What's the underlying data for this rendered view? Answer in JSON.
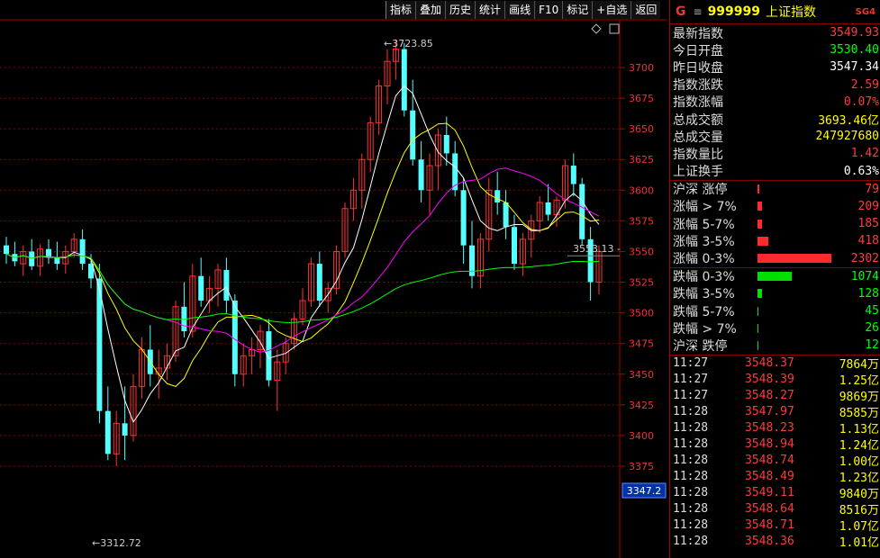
{
  "toolbar": {
    "buttons": [
      "指标",
      "叠加",
      "历史",
      "统计",
      "画线",
      "F10",
      "标记",
      "+自选",
      "返回"
    ]
  },
  "chart": {
    "y_ticks": [
      "3700",
      "3675",
      "3650",
      "3625",
      "3600",
      "3575",
      "3550",
      "3525",
      "3500",
      "3475",
      "3450",
      "3425",
      "3400",
      "3375"
    ],
    "high_label": "3723.85",
    "low_label": "3312.72",
    "current_label": "3553.13",
    "cursor_price": "3347.2",
    "diamond_icon": "diamond-icon",
    "window_icon": "window-icon"
  },
  "chart_data": {
    "type": "candlestick",
    "ylim": [
      3300,
      3740
    ],
    "grid": true,
    "candles": [
      [
        3555,
        3562,
        3540,
        3548
      ],
      [
        3548,
        3558,
        3538,
        3542
      ],
      [
        3540,
        3555,
        3530,
        3550
      ],
      [
        3550,
        3560,
        3535,
        3538
      ],
      [
        3538,
        3556,
        3530,
        3552
      ],
      [
        3552,
        3560,
        3540,
        3545
      ],
      [
        3545,
        3558,
        3535,
        3540
      ],
      [
        3540,
        3555,
        3532,
        3550
      ],
      [
        3550,
        3565,
        3545,
        3560
      ],
      [
        3560,
        3568,
        3535,
        3540
      ],
      [
        3540,
        3548,
        3520,
        3528
      ],
      [
        3528,
        3540,
        3410,
        3420
      ],
      [
        3420,
        3440,
        3380,
        3385
      ],
      [
        3385,
        3420,
        3375,
        3410
      ],
      [
        3410,
        3440,
        3380,
        3400
      ],
      [
        3400,
        3450,
        3395,
        3440
      ],
      [
        3440,
        3480,
        3430,
        3470
      ],
      [
        3470,
        3490,
        3440,
        3450
      ],
      [
        3450,
        3470,
        3430,
        3455
      ],
      [
        3455,
        3475,
        3445,
        3465
      ],
      [
        3465,
        3510,
        3460,
        3505
      ],
      [
        3505,
        3525,
        3480,
        3485
      ],
      [
        3485,
        3540,
        3480,
        3530
      ],
      [
        3530,
        3545,
        3505,
        3510
      ],
      [
        3510,
        3530,
        3500,
        3520
      ],
      [
        3520,
        3540,
        3505,
        3535
      ],
      [
        3535,
        3545,
        3500,
        3510
      ],
      [
        3510,
        3515,
        3440,
        3450
      ],
      [
        3450,
        3475,
        3440,
        3465
      ],
      [
        3465,
        3480,
        3450,
        3470
      ],
      [
        3470,
        3490,
        3455,
        3485
      ],
      [
        3485,
        3495,
        3440,
        3445
      ],
      [
        3445,
        3470,
        3420,
        3460
      ],
      [
        3460,
        3480,
        3450,
        3475
      ],
      [
        3475,
        3500,
        3470,
        3495
      ],
      [
        3495,
        3520,
        3490,
        3510
      ],
      [
        3510,
        3545,
        3505,
        3540
      ],
      [
        3540,
        3550,
        3505,
        3510
      ],
      [
        3510,
        3525,
        3500,
        3520
      ],
      [
        3520,
        3555,
        3515,
        3550
      ],
      [
        3550,
        3590,
        3545,
        3585
      ],
      [
        3585,
        3610,
        3575,
        3600
      ],
      [
        3600,
        3630,
        3585,
        3625
      ],
      [
        3625,
        3660,
        3615,
        3655
      ],
      [
        3655,
        3690,
        3645,
        3685
      ],
      [
        3685,
        3715,
        3670,
        3705
      ],
      [
        3705,
        3723,
        3690,
        3715
      ],
      [
        3715,
        3720,
        3660,
        3665
      ],
      [
        3665,
        3690,
        3620,
        3625
      ],
      [
        3625,
        3640,
        3590,
        3600
      ],
      [
        3600,
        3630,
        3580,
        3620
      ],
      [
        3620,
        3650,
        3600,
        3645
      ],
      [
        3645,
        3660,
        3620,
        3630
      ],
      [
        3630,
        3640,
        3595,
        3600
      ],
      [
        3600,
        3610,
        3540,
        3555
      ],
      [
        3555,
        3575,
        3520,
        3530
      ],
      [
        3530,
        3565,
        3520,
        3560
      ],
      [
        3560,
        3610,
        3550,
        3600
      ],
      [
        3600,
        3615,
        3580,
        3590
      ],
      [
        3590,
        3600,
        3560,
        3570
      ],
      [
        3570,
        3580,
        3535,
        3540
      ],
      [
        3540,
        3565,
        3530,
        3560
      ],
      [
        3560,
        3580,
        3545,
        3575
      ],
      [
        3575,
        3595,
        3565,
        3590
      ],
      [
        3590,
        3605,
        3575,
        3580
      ],
      [
        3580,
        3595,
        3570,
        3592
      ],
      [
        3592,
        3625,
        3585,
        3620
      ],
      [
        3620,
        3630,
        3595,
        3605
      ],
      [
        3605,
        3610,
        3555,
        3560
      ],
      [
        3560,
        3570,
        3510,
        3525
      ],
      [
        3525,
        3555,
        3515,
        3550
      ]
    ],
    "ma_yellow_note": "5-day moving average",
    "ma_white_note": "10-day moving average",
    "ma_magenta_note": "20-day moving average",
    "ma_green_note": "60-day moving average"
  },
  "panel": {
    "header": {
      "g": "G",
      "menu": "≡",
      "code": "999999",
      "name": "上证指数",
      "sg": "SG4"
    },
    "stats": [
      {
        "label": "最新指数",
        "value": "3549.93",
        "color": "#ff3b3b"
      },
      {
        "label": "今日开盘",
        "value": "3530.40",
        "color": "#00ff00"
      },
      {
        "label": "昨日收盘",
        "value": "3547.34",
        "color": "#ffffff"
      },
      {
        "label": "指数涨跌",
        "value": "2.59",
        "color": "#ff3b3b"
      },
      {
        "label": "指数涨幅",
        "value": "0.07%",
        "color": "#ff3b3b"
      },
      {
        "label": "总成交额",
        "value": "3693.46亿",
        "color": "#ffff00"
      },
      {
        "label": "总成交量",
        "value": "247927680",
        "color": "#ffff00"
      },
      {
        "label": "指数量比",
        "value": "1.42",
        "color": "#ff3b3b"
      },
      {
        "label": "上证换手",
        "value": "0.63%",
        "color": "#ffffff"
      }
    ],
    "up": [
      {
        "label": "沪深 涨停",
        "value": "79",
        "width": 2
      },
      {
        "label": "涨幅 > 7%",
        "value": "209",
        "width": 5
      },
      {
        "label": "涨幅 5-7%",
        "value": "185",
        "width": 5
      },
      {
        "label": "涨幅 3-5%",
        "value": "418",
        "width": 12
      },
      {
        "label": "涨幅 0-3%",
        "value": "2302",
        "width": 82
      }
    ],
    "down": [
      {
        "label": "跌幅 0-3%",
        "value": "1074",
        "width": 38
      },
      {
        "label": "跌幅 3-5%",
        "value": "128",
        "width": 5
      },
      {
        "label": "跌幅 5-7%",
        "value": "45",
        "width": 1
      },
      {
        "label": "跌幅 > 7%",
        "value": "26",
        "width": 1
      },
      {
        "label": "沪深 跌停",
        "value": "12",
        "width": 1
      }
    ],
    "ticks": [
      {
        "t": "11:27",
        "p": "3548.37",
        "v": "7864万"
      },
      {
        "t": "11:27",
        "p": "3548.39",
        "v": "1.25亿"
      },
      {
        "t": "11:27",
        "p": "3548.27",
        "v": "9869万"
      },
      {
        "t": "11:28",
        "p": "3547.97",
        "v": "8585万"
      },
      {
        "t": "11:28",
        "p": "3548.23",
        "v": "1.13亿"
      },
      {
        "t": "11:28",
        "p": "3548.94",
        "v": "1.24亿"
      },
      {
        "t": "11:28",
        "p": "3548.74",
        "v": "1.00亿"
      },
      {
        "t": "11:28",
        "p": "3548.49",
        "v": "1.23亿"
      },
      {
        "t": "11:28",
        "p": "3549.11",
        "v": "9840万"
      },
      {
        "t": "11:28",
        "p": "3548.64",
        "v": "8516万"
      },
      {
        "t": "11:28",
        "p": "3548.71",
        "v": "1.07亿"
      },
      {
        "t": "11:28",
        "p": "3548.36",
        "v": "1.01亿"
      }
    ]
  }
}
